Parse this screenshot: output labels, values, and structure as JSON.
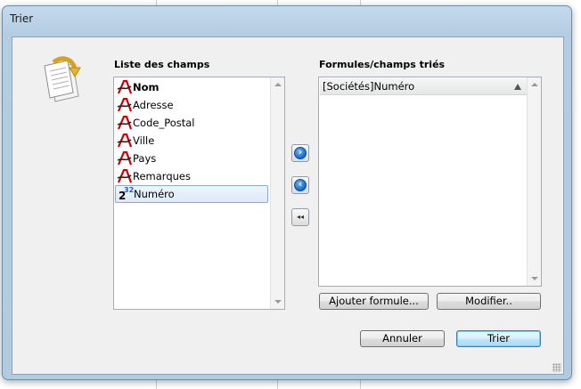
{
  "window": {
    "title": "Trier"
  },
  "fields_panel": {
    "label": "Liste des champs",
    "items": [
      {
        "label": "Nom",
        "icon": "alpha-field-icon",
        "bold": true
      },
      {
        "label": "Adresse",
        "icon": "alpha-field-icon"
      },
      {
        "label": "Code_Postal",
        "icon": "alpha-field-icon"
      },
      {
        "label": "Ville",
        "icon": "alpha-field-icon"
      },
      {
        "label": "Pays",
        "icon": "alpha-field-icon"
      },
      {
        "label": "Remarques",
        "icon": "alpha-field-icon"
      },
      {
        "label": "Numéro",
        "icon": "numeric-field-icon",
        "icon_text": "2",
        "icon_sup": "32",
        "selected": true
      }
    ]
  },
  "sorted_panel": {
    "label": "Formules/champs triés",
    "items": [
      {
        "label": "[Sociétés]Numéro",
        "order": "ascending"
      }
    ]
  },
  "transfer_buttons": {
    "add": "›",
    "remove": "‹",
    "remove_all": "◂◂"
  },
  "buttons": {
    "add_formula": "Ajouter formule...",
    "modify": "Modifier..",
    "cancel": "Annuler",
    "sort": "Trier"
  }
}
